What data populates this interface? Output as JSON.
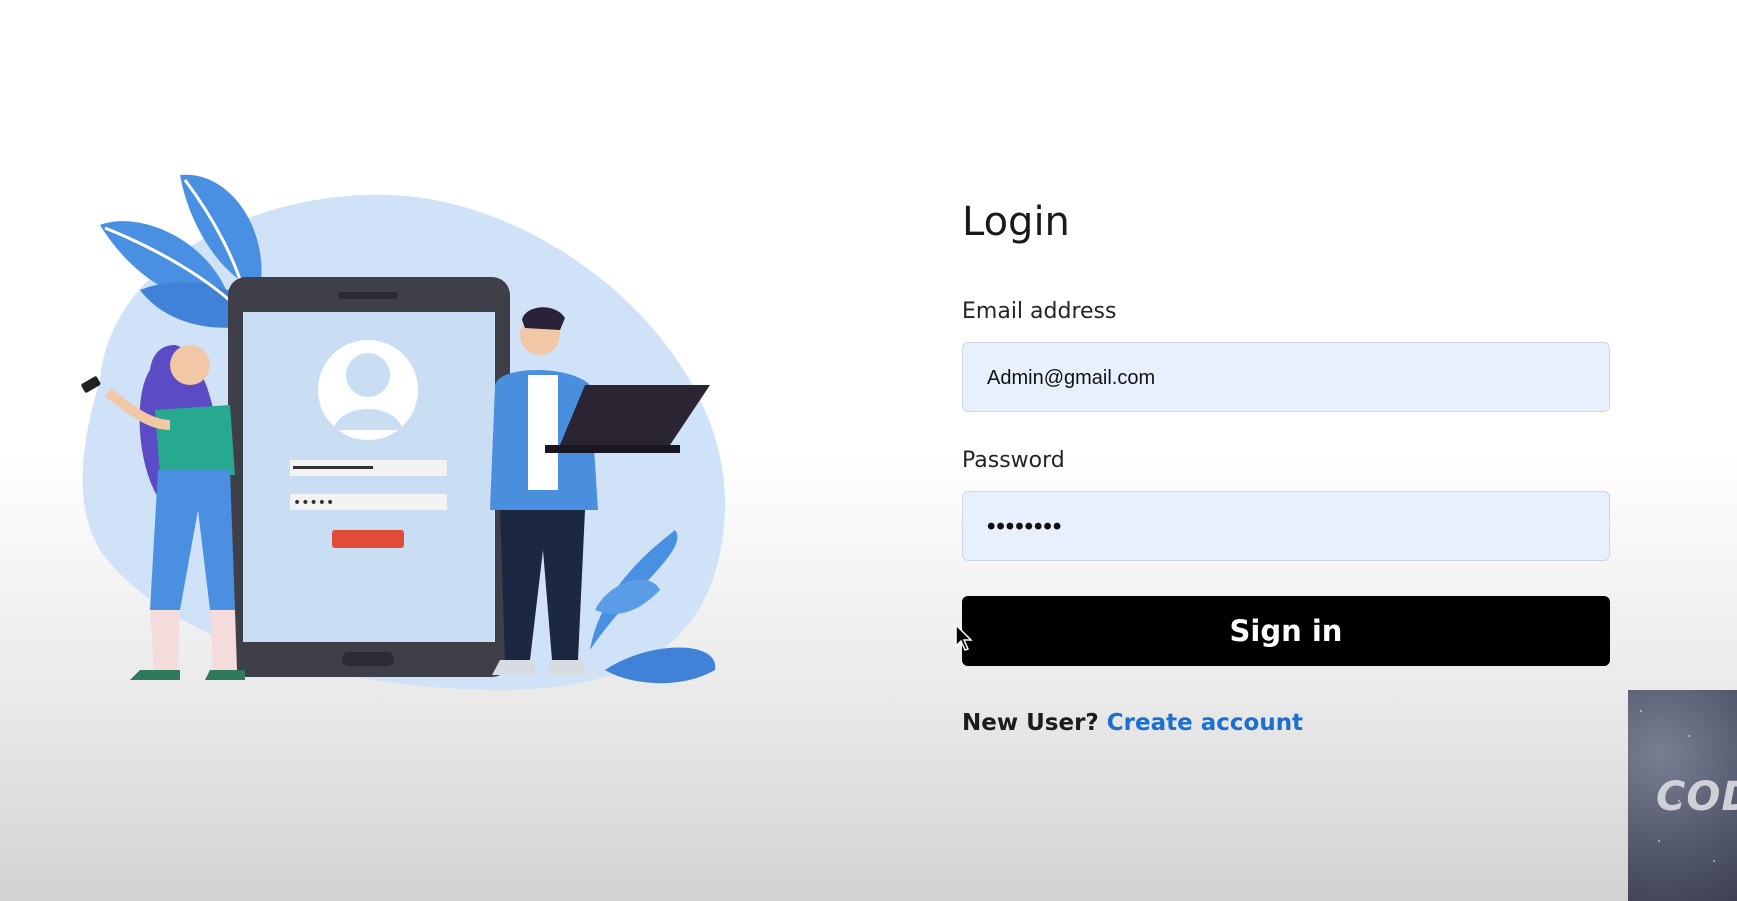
{
  "login": {
    "title": "Login",
    "email_label": "Email address",
    "email_value": "Admin@gmail.com",
    "password_label": "Password",
    "password_masked": "••••••••",
    "signin_label": "Sign in",
    "new_user_prompt": "New User?",
    "create_account_label": "Create account"
  },
  "illustration": {
    "icons": [
      "login-phone-illustration",
      "woman-with-phone",
      "man-with-laptop",
      "leaf-decoration"
    ]
  },
  "overlay": {
    "text": "COD"
  },
  "colors": {
    "input_bg": "#e8f0fe",
    "button_bg": "#000000",
    "link": "#1a6fd1",
    "accent_blue": "#4a90e2"
  }
}
